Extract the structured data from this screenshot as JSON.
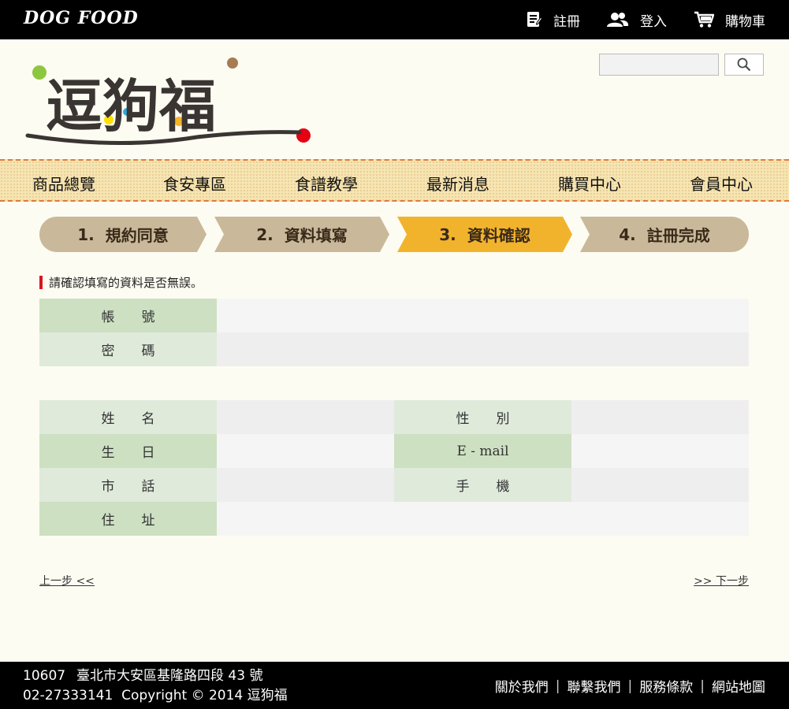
{
  "header": {
    "brand": "DOG FOOD",
    "nav": [
      {
        "label": "註冊",
        "icon": "register-icon"
      },
      {
        "label": "登入",
        "icon": "users-icon"
      },
      {
        "label": "購物車",
        "icon": "cart-icon"
      }
    ],
    "logo_text": "逗狗福",
    "search": {
      "value": "",
      "placeholder": ""
    }
  },
  "main_nav": [
    "商品總覽",
    "食安專區",
    "食譜教學",
    "最新消息",
    "購買中心",
    "會員中心"
  ],
  "steps": [
    {
      "num": "1.",
      "label": "規約同意",
      "active": false
    },
    {
      "num": "2.",
      "label": "資料填寫",
      "active": false
    },
    {
      "num": "3.",
      "label": "資料確認",
      "active": true
    },
    {
      "num": "4.",
      "label": "註冊完成",
      "active": false
    }
  ],
  "notice": "請確認填寫的資料是否無誤。",
  "account": {
    "username_label": "帳　　號",
    "username_value": "",
    "password_label": "密　　碼",
    "password_value": ""
  },
  "profile": {
    "name_label": "姓　　名",
    "name_value": "",
    "gender_label": "性　　別",
    "gender_value": "",
    "birthday_label": "生　　日",
    "birthday_value": "",
    "email_label": "E - mail",
    "email_value": "",
    "phone_label": "市　　話",
    "phone_value": "",
    "mobile_label": "手　　機",
    "mobile_value": "",
    "address_label": "住　　址",
    "address_value": ""
  },
  "pager": {
    "prev": "上一步 <<",
    "next": ">> 下一步"
  },
  "footer": {
    "zip": "10607",
    "address": "臺北市大安區基隆路四段 43 號",
    "phone": "02-27333141",
    "copyright": "Copyright © 2014 逗狗福",
    "links": [
      "關於我們",
      "聯繫我們",
      "服務條款",
      "網站地圖"
    ]
  },
  "colors": {
    "accent": "#f2b32c",
    "step_inactive": "#c9b99a",
    "label_dark": "#cde0c2",
    "label_light": "#dfeadb",
    "notice_bar": "#d8161e"
  }
}
